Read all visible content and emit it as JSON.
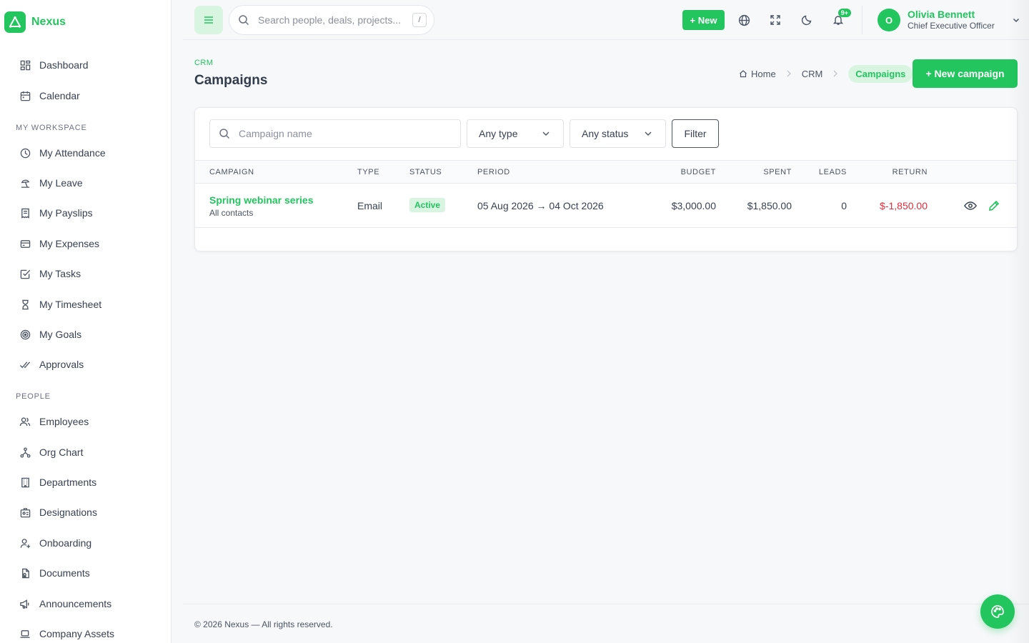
{
  "brand": {
    "name": "Nexus"
  },
  "sidebar": {
    "top_items": [
      {
        "label": "Dashboard",
        "icon": "dashboard-icon"
      },
      {
        "label": "Calendar",
        "icon": "calendar-icon"
      }
    ],
    "sections": [
      {
        "title": "MY WORKSPACE",
        "items": [
          {
            "label": "My Attendance",
            "icon": "clock-icon"
          },
          {
            "label": "My Leave",
            "icon": "beach-icon"
          },
          {
            "label": "My Payslips",
            "icon": "receipt-icon"
          },
          {
            "label": "My Expenses",
            "icon": "card-icon"
          },
          {
            "label": "My Tasks",
            "icon": "checkbox-icon"
          },
          {
            "label": "My Timesheet",
            "icon": "hourglass-icon"
          },
          {
            "label": "My Goals",
            "icon": "target-icon"
          },
          {
            "label": "Approvals",
            "icon": "double-check-icon"
          }
        ]
      },
      {
        "title": "PEOPLE",
        "items": [
          {
            "label": "Employees",
            "icon": "users-icon"
          },
          {
            "label": "Org Chart",
            "icon": "hierarchy-icon"
          },
          {
            "label": "Departments",
            "icon": "building-icon"
          },
          {
            "label": "Designations",
            "icon": "id-badge-icon"
          },
          {
            "label": "Onboarding",
            "icon": "user-plus-icon"
          },
          {
            "label": "Documents",
            "icon": "document-icon"
          },
          {
            "label": "Announcements",
            "icon": "megaphone-icon"
          },
          {
            "label": "Company Assets",
            "icon": "laptop-icon"
          }
        ]
      }
    ]
  },
  "header": {
    "search_placeholder": "Search people, deals, projects...",
    "search_shortcut": "/",
    "new_label": "+ New",
    "notifications_badge": "9+",
    "user": {
      "initial": "O",
      "name": "Olivia Bennett",
      "role": "Chief Executive Officer"
    }
  },
  "page": {
    "section": "CRM",
    "title": "Campaigns",
    "breadcrumb": {
      "home": "Home",
      "middle": "CRM",
      "current": "Campaigns"
    },
    "new_button": "+ New campaign"
  },
  "filters": {
    "name_placeholder": "Campaign name",
    "type_value": "Any type",
    "status_value": "Any status",
    "filter_button": "Filter"
  },
  "table": {
    "columns": {
      "campaign": "CAMPAIGN",
      "type": "TYPE",
      "status": "STATUS",
      "period": "PERIOD",
      "budget": "BUDGET",
      "spent": "SPENT",
      "leads": "LEADS",
      "return": "RETURN"
    },
    "rows": [
      {
        "name": "Spring webinar series",
        "audience": "All contacts",
        "type": "Email",
        "status": "Active",
        "period": "05 Aug 2026 → 04 Oct 2026",
        "budget": "$3,000.00",
        "spent": "$1,850.00",
        "leads": "0",
        "return": "$-1,850.00"
      }
    ]
  },
  "footer": {
    "copyright": "© 2026 Nexus — All rights reserved."
  },
  "colors": {
    "accent": "#22c55e",
    "accent_soft": "#d9f5e2",
    "negative": "#e02d3c"
  }
}
